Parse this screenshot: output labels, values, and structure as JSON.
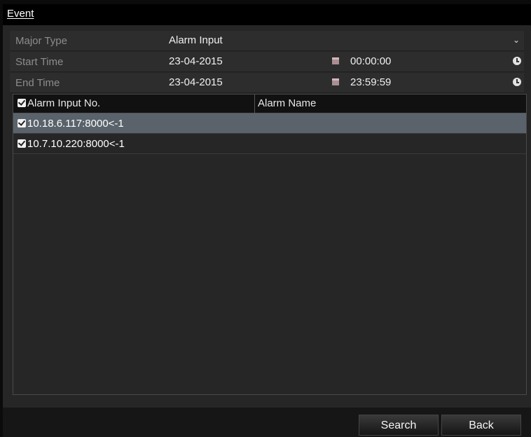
{
  "window": {
    "title": "Event"
  },
  "form": {
    "major_type": {
      "label": "Major Type",
      "value": "Alarm Input"
    },
    "start_time": {
      "label": "Start Time",
      "date": "23-04-2015",
      "time": "00:00:00"
    },
    "end_time": {
      "label": "End Time",
      "date": "23-04-2015",
      "time": "23:59:59"
    }
  },
  "table": {
    "columns": [
      "Alarm Input No.",
      "Alarm Name"
    ],
    "header_checked": true,
    "rows": [
      {
        "input_no": "10.18.6.117:8000<-1",
        "name": "",
        "checked": true,
        "selected": true
      },
      {
        "input_no": "10.7.10.220:8000<-1",
        "name": "",
        "checked": true,
        "selected": false
      }
    ]
  },
  "buttons": {
    "search": "Search",
    "back": "Back"
  },
  "icons": {
    "dropdown": "chevron-down-icon",
    "date": "calendar-icon",
    "time": "clock-icon",
    "check": "checkbox-checked-icon"
  }
}
